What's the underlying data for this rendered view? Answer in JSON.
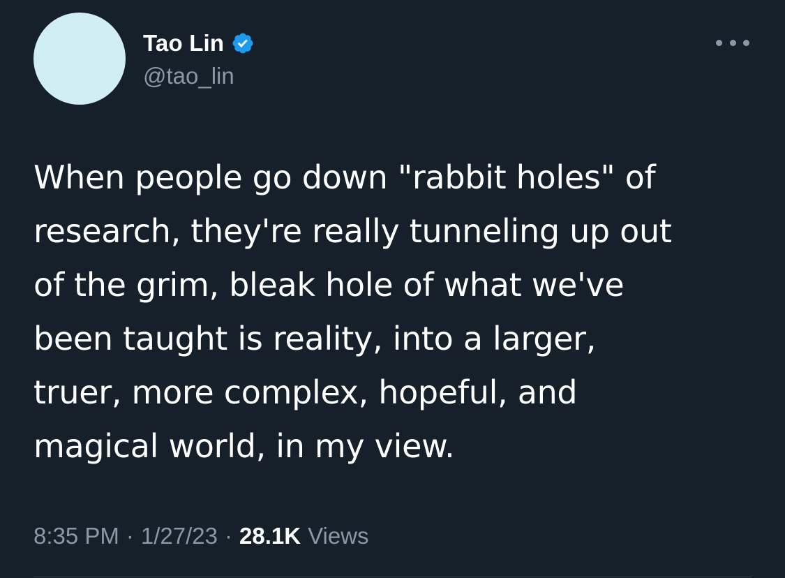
{
  "author": {
    "display_name": "Tao Lin",
    "handle": "@tao_lin",
    "verified_icon": "verified-badge-icon",
    "avatar_color": "#d0eef4"
  },
  "more_menu_icon": "more-horizontal-icon",
  "tweet": {
    "text": "When people go down \"rabbit holes\" of\nresearch, they're really tunneling up out\nof the grim, bleak hole of what we've\nbeen taught is reality, into a larger,\ntruer, more complex, hopeful, and\nmagical world, in my view."
  },
  "meta": {
    "time": "8:35 PM",
    "separator": "·",
    "date": "1/27/23",
    "views_count": "28.1K",
    "views_label": "Views"
  },
  "colors": {
    "background": "#15202b",
    "text": "#ffffff",
    "secondary_text": "#8b98a5",
    "verified_blue": "#1d9bf0"
  }
}
